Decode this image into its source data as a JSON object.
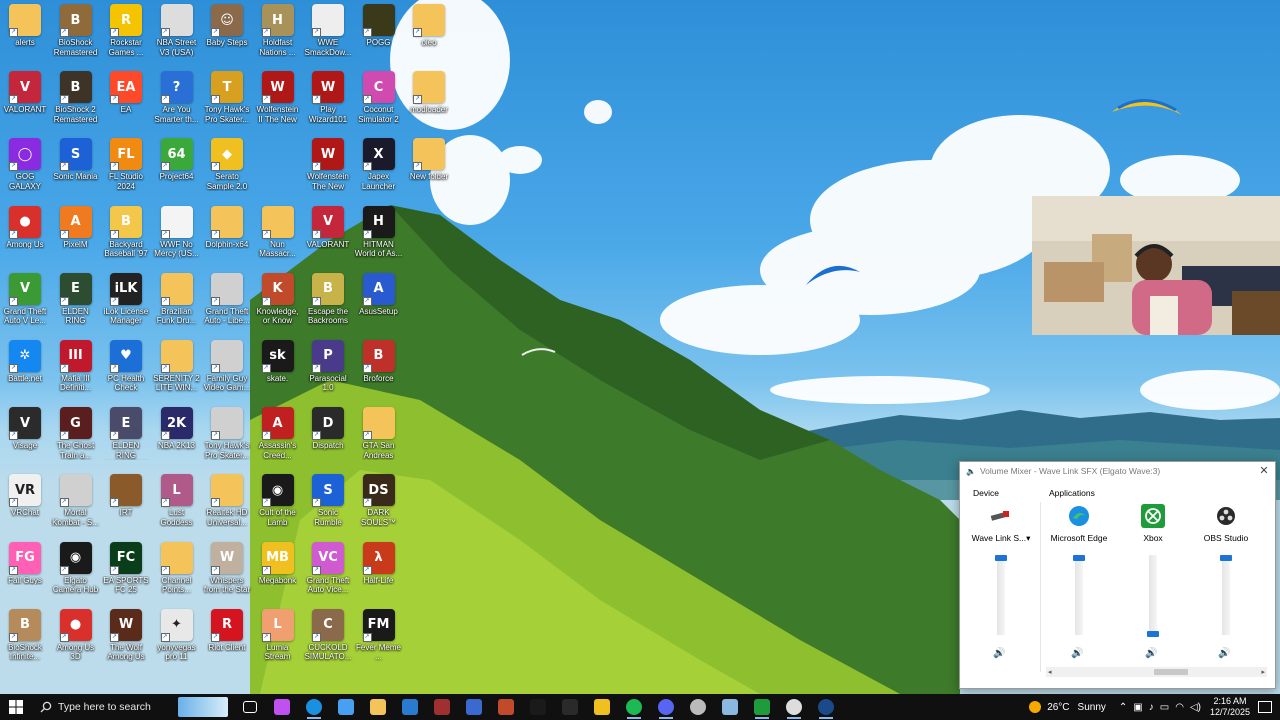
{
  "desktop": {
    "icons": [
      {
        "name": "alerts",
        "color": "#f4c35a",
        "glyph": ""
      },
      {
        "name": "VALORANT",
        "color": "#c4273b",
        "glyph": "V"
      },
      {
        "name": "GOG GALAXY",
        "color": "#8a2be2",
        "glyph": "◯"
      },
      {
        "name": "Among Us",
        "color": "#d9302b",
        "glyph": "●"
      },
      {
        "name": "Grand Theft Auto V Le...",
        "color": "#3c9a34",
        "glyph": "V"
      },
      {
        "name": "Battle.net",
        "color": "#1587f0",
        "glyph": "✲"
      },
      {
        "name": "Visage",
        "color": "#2b2b2b",
        "glyph": "V"
      },
      {
        "name": "VRChat",
        "color": "#f0f0f0",
        "glyph": "VR"
      },
      {
        "name": "Fall Guys",
        "color": "#ff5fb4",
        "glyph": "FG"
      },
      {
        "name": "BioShock Infinite...",
        "color": "#b58b5b",
        "glyph": "B"
      },
      {
        "name": "BioShock Remastered",
        "color": "#8f6a3a",
        "glyph": "B"
      },
      {
        "name": "BioShock 2 Remastered",
        "color": "#3d3326",
        "glyph": "B"
      },
      {
        "name": "Sonic Mania",
        "color": "#1c62d6",
        "glyph": "S"
      },
      {
        "name": "PixelM",
        "color": "#f07a20",
        "glyph": "A"
      },
      {
        "name": "ELDEN RING",
        "color": "#2c4d2f",
        "glyph": "E"
      },
      {
        "name": "Mafia III Definiti...",
        "color": "#c0182d",
        "glyph": "III"
      },
      {
        "name": "The Ghost Train a...",
        "color": "#5a1e1e",
        "glyph": "G"
      },
      {
        "name": "Mortal Kombat - S...",
        "color": "#d0d0d0",
        "glyph": ""
      },
      {
        "name": "Elgato Camera Hub",
        "color": "#1a1a1a",
        "glyph": "◉"
      },
      {
        "name": "Among Us 3D",
        "color": "#d9302b",
        "glyph": "●"
      },
      {
        "name": "Rockstar Games ...",
        "color": "#f5c400",
        "glyph": "R"
      },
      {
        "name": "EA",
        "color": "#ff4a2a",
        "glyph": "EA"
      },
      {
        "name": "FL Studio 2024",
        "color": "#f08a10",
        "glyph": "FL"
      },
      {
        "name": "Backyard Baseball '97",
        "color": "#f2c74a",
        "glyph": "B"
      },
      {
        "name": "iLok License Manager",
        "color": "#222222",
        "glyph": "iLK"
      },
      {
        "name": "PC Health Check",
        "color": "#1b6fd6",
        "glyph": "♥"
      },
      {
        "name": "ELDEN RING NIGHTREIGN",
        "color": "#4a4a6a",
        "glyph": "E"
      },
      {
        "name": "IRT",
        "color": "#8a5a2a",
        "glyph": ""
      },
      {
        "name": "EA SPORTS FC 25",
        "color": "#0a3d1a",
        "glyph": "FC"
      },
      {
        "name": "The Wolf Among Us",
        "color": "#5a2a1a",
        "glyph": "W"
      },
      {
        "name": "NBA Street V3 (USA)",
        "color": "#dddddd",
        "glyph": ""
      },
      {
        "name": "Are You Smarter th...",
        "color": "#2a6fd6",
        "glyph": "?"
      },
      {
        "name": "Project64",
        "color": "#3aa83a",
        "glyph": "64"
      },
      {
        "name": "WWF No Mercy (US...",
        "color": "#f4f4f4",
        "glyph": ""
      },
      {
        "name": "Brazilian Funk Dru...",
        "color": "#f4c35a",
        "glyph": ""
      },
      {
        "name": "SERENITY 2 LITE WIN...",
        "color": "#f4c35a",
        "glyph": ""
      },
      {
        "name": "NBA 2K13",
        "color": "#2a2a6a",
        "glyph": "2K"
      },
      {
        "name": "Lust Goddess",
        "color": "#b05a8a",
        "glyph": "L"
      },
      {
        "name": "Channel Points...",
        "color": "#f4c35a",
        "glyph": ""
      },
      {
        "name": "yonyvegas pro 11",
        "color": "#e8e8e8",
        "glyph": "✦"
      },
      {
        "name": "Baby Steps",
        "color": "#8a6a4a",
        "glyph": "☺"
      },
      {
        "name": "Tony Hawk's Pro Skater...",
        "color": "#d8a020",
        "glyph": "T"
      },
      {
        "name": "Serato Sample 2.0",
        "color": "#f0c020",
        "glyph": "◆"
      },
      {
        "name": "Dolphin-x64",
        "color": "#f4c35a",
        "glyph": ""
      },
      {
        "name": "Grand Theft Auto - Libe...",
        "color": "#d0d0d0",
        "glyph": ""
      },
      {
        "name": "Family Guy Video Gam...",
        "color": "#d0d0d0",
        "glyph": ""
      },
      {
        "name": "Tony Hawk's Pro Skater...",
        "color": "#d0d0d0",
        "glyph": ""
      },
      {
        "name": "Realtek HD Universal...",
        "color": "#f4c35a",
        "glyph": ""
      },
      {
        "name": "Whispers from the Star",
        "color": "#c0b0a0",
        "glyph": "W"
      },
      {
        "name": "Riot Client",
        "color": "#d4141e",
        "glyph": "R"
      },
      {
        "name": "Holdfast Nations ...",
        "color": "#a8925a",
        "glyph": "H"
      },
      {
        "name": "Wolfenstein II The New C...",
        "color": "#b01818",
        "glyph": "W"
      },
      {
        "name": "",
        "color": "transparent",
        "glyph": ""
      },
      {
        "name": "Nun Massacr...",
        "color": "#f4c35a",
        "glyph": ""
      },
      {
        "name": "Knowledge, or Know Lady",
        "color": "#c04a2a",
        "glyph": "K"
      },
      {
        "name": "skate.",
        "color": "#1a1a1a",
        "glyph": "sk"
      },
      {
        "name": "Assassin's Creed...",
        "color": "#c02020",
        "glyph": "A"
      },
      {
        "name": "Cult of the Lamb",
        "color": "#1a1a1a",
        "glyph": "◉"
      },
      {
        "name": "Megabonk",
        "color": "#f0c020",
        "glyph": "MB"
      },
      {
        "name": "Lumia Stream",
        "color": "#f0a070",
        "glyph": "L"
      },
      {
        "name": "WWE SmackDow...",
        "color": "#eeeeee",
        "glyph": ""
      },
      {
        "name": "Play Wizard101",
        "color": "#b01818",
        "glyph": "W"
      },
      {
        "name": "Wolfenstein The New Or...",
        "color": "#b01818",
        "glyph": "W"
      },
      {
        "name": "VALORANT",
        "color": "#c4273b",
        "glyph": "V"
      },
      {
        "name": "Escape the Backrooms",
        "color": "#c8b24a",
        "glyph": "B"
      },
      {
        "name": "Parasocial 1.0",
        "color": "#4a3a8a",
        "glyph": "P"
      },
      {
        "name": "Dispatch",
        "color": "#2a2a2a",
        "glyph": "D"
      },
      {
        "name": "Sonic Rumble",
        "color": "#1c62d6",
        "glyph": "S"
      },
      {
        "name": "Grand Theft Auto Vice...",
        "color": "#d05ad0",
        "glyph": "VC"
      },
      {
        "name": "CUCKOLD SIMULATO...",
        "color": "#8a6a4a",
        "glyph": "C"
      },
      {
        "name": "POGG",
        "color": "#3a3a1a",
        "glyph": ""
      },
      {
        "name": "Coconut Simulator 2",
        "color": "#d04ab0",
        "glyph": "C"
      },
      {
        "name": "Japex Launcher",
        "color": "#1a1a2a",
        "glyph": "X"
      },
      {
        "name": "HITMAN World of As...",
        "color": "#1a1a1a",
        "glyph": "H"
      },
      {
        "name": "AsusSetup",
        "color": "#2a5ad0",
        "glyph": "A"
      },
      {
        "name": "Broforce",
        "color": "#c0302a",
        "glyph": "B"
      },
      {
        "name": "GTA San Andreas",
        "color": "#f4c35a",
        "glyph": ""
      },
      {
        "name": "DARK SOULS™ RE...",
        "color": "#3a2a1a",
        "glyph": "DS"
      },
      {
        "name": "Half-Life",
        "color": "#c83a1a",
        "glyph": "λ"
      },
      {
        "name": "Fever Meme ...",
        "color": "#1a1a1a",
        "glyph": "FM"
      },
      {
        "name": "oleo",
        "color": "#f4c35a",
        "glyph": ""
      },
      {
        "name": "modloader",
        "color": "#f4c35a",
        "glyph": ""
      },
      {
        "name": "New folder",
        "color": "#f4c35a",
        "glyph": ""
      }
    ]
  },
  "mixer": {
    "title": "Volume Mixer - Wave Link SFX (Elgato Wave:3)",
    "close_glyph": "✕",
    "device_label": "Device",
    "applications_label": "Applications",
    "channels": [
      {
        "name": "Wave Link S...",
        "level": 1.0,
        "icon": "speaker-icon",
        "color": "#444444",
        "dropdown": "▾"
      },
      {
        "name": "Microsoft Edge",
        "level": 1.0,
        "icon": "edge-icon",
        "color": "#1b8fe0"
      },
      {
        "name": "Xbox",
        "level": 0.0,
        "icon": "xbox-icon",
        "color": "#1e9b3a"
      },
      {
        "name": "OBS Studio",
        "level": 1.0,
        "icon": "obs-icon",
        "color": "#2a2a2a"
      }
    ],
    "speaker_glyph": "🔊",
    "scroll_left": "◂",
    "scroll_right": "▸"
  },
  "taskbar": {
    "search_placeholder": "Type here to search",
    "apps": [
      {
        "name": "task-view",
        "color": "#ffffff",
        "active": false
      },
      {
        "name": "copilot",
        "color": "#c050f0",
        "active": false
      },
      {
        "name": "edge",
        "color": "#1b8fe0",
        "active": true
      },
      {
        "name": "store",
        "color": "#4aa0f0",
        "active": false
      },
      {
        "name": "file-explorer",
        "color": "#f4c35a",
        "active": false
      },
      {
        "name": "mail",
        "color": "#2a7ad0",
        "active": false
      },
      {
        "name": "game-1",
        "color": "#a03030",
        "active": false
      },
      {
        "name": "fall-guys",
        "color": "#3a6ad0",
        "active": false
      },
      {
        "name": "megabonk",
        "color": "#c04a2a",
        "active": false
      },
      {
        "name": "dispatch",
        "color": "#1a1a1a",
        "active": false
      },
      {
        "name": "skate",
        "color": "#2a2a2a",
        "active": false
      },
      {
        "name": "ilok",
        "color": "#f0c020",
        "active": false
      },
      {
        "name": "spotify",
        "color": "#1db954",
        "active": true
      },
      {
        "name": "discord",
        "color": "#5865f2",
        "active": true
      },
      {
        "name": "app-generic",
        "color": "#bbbbbb",
        "active": false
      },
      {
        "name": "notepad",
        "color": "#8ab8e0",
        "active": false
      },
      {
        "name": "xbox",
        "color": "#1e9b3a",
        "active": true
      },
      {
        "name": "obs",
        "color": "#dddddd",
        "active": true
      },
      {
        "name": "steam",
        "color": "#1a4a8a",
        "active": true
      }
    ],
    "weather": {
      "temp": "26°C",
      "condition": "Sunny"
    },
    "clock": {
      "time": "2:16 AM",
      "date": "12/7/2025"
    }
  }
}
